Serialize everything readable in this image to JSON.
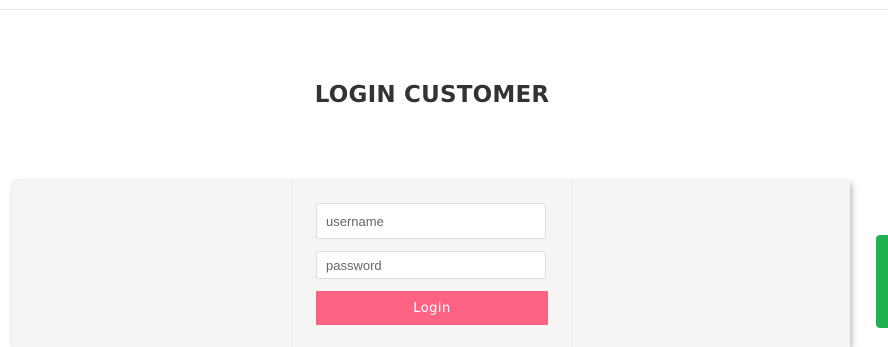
{
  "page": {
    "title": "LOGIN CUSTOMER"
  },
  "form": {
    "username_placeholder": "username",
    "password_placeholder": "password",
    "login_label": "Login"
  },
  "colors": {
    "accent": "#ff6384",
    "side_widget": "#1fb04f",
    "panel_background": "#f5f5f5",
    "title_text": "#333333"
  }
}
